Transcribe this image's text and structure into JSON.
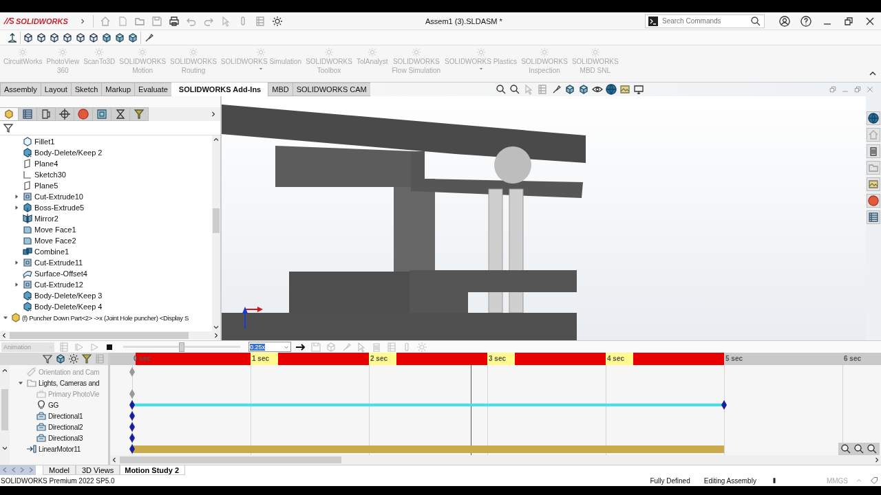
{
  "title_bar": {
    "app_name": "SOLIDWORKS",
    "document_title": "Assem1 (3).SLDASM *",
    "search": {
      "placeholder": "Search Commands"
    }
  },
  "command_manager": {
    "addins": [
      {
        "label": "CircuitWorks",
        "disabled": true,
        "dropdown": false
      },
      {
        "label": "PhotoView\n360",
        "disabled": true,
        "dropdown": false
      },
      {
        "label": "ScanTo3D",
        "disabled": true,
        "dropdown": false
      },
      {
        "label": "SOLIDWORKS\nMotion",
        "disabled": true,
        "dropdown": false
      },
      {
        "label": "SOLIDWORKS\nRouting",
        "disabled": true,
        "dropdown": false
      },
      {
        "label": "SOLIDWORKS Simulation",
        "disabled": true,
        "dropdown": true
      },
      {
        "label": "SOLIDWORKS\nToolbox",
        "disabled": true,
        "dropdown": false
      },
      {
        "label": "TolAnalyst",
        "disabled": true,
        "dropdown": false
      },
      {
        "label": "SOLIDWORKS\nFlow Simulation",
        "disabled": true,
        "dropdown": false
      },
      {
        "label": "SOLIDWORKS Plastics",
        "disabled": true,
        "dropdown": true
      },
      {
        "label": "SOLIDWORKS\nInspection",
        "disabled": true,
        "dropdown": false
      },
      {
        "label": "SOLIDWORKS\nMBD SNL",
        "disabled": true,
        "dropdown": false
      }
    ],
    "tabs": [
      {
        "label": "Assembly",
        "selected": false
      },
      {
        "label": "Layout",
        "selected": false
      },
      {
        "label": "Sketch",
        "selected": false
      },
      {
        "label": "Markup",
        "selected": false
      },
      {
        "label": "Evaluate",
        "selected": false
      },
      {
        "label": "SOLIDWORKS Add-Ins",
        "selected": true
      },
      {
        "label": "MBD",
        "selected": false
      },
      {
        "label": "SOLIDWORKS CAM",
        "selected": false
      }
    ]
  },
  "feature_manager": {
    "panel_tabs": [
      {
        "kind": "part",
        "selected": true
      },
      {
        "kind": "list",
        "selected": false
      },
      {
        "kind": "config",
        "selected": false
      },
      {
        "kind": "target",
        "selected": false
      },
      {
        "kind": "appearance",
        "selected": false
      },
      {
        "kind": "display",
        "selected": false
      },
      {
        "kind": "hourglass",
        "selected": false
      },
      {
        "kind": "funnel",
        "selected": false
      }
    ],
    "features": [
      {
        "label": "Fillet1",
        "kind": "fillet"
      },
      {
        "label": "Body-Delete/Keep 2",
        "kind": "body-delete"
      },
      {
        "label": "Plane4",
        "kind": "plane"
      },
      {
        "label": "Sketch30",
        "kind": "sketch"
      },
      {
        "label": "Plane5",
        "kind": "plane"
      },
      {
        "label": "Cut-Extrude10",
        "kind": "cut",
        "expanded": false
      },
      {
        "label": "Boss-Extrude5",
        "kind": "boss",
        "expanded": false
      },
      {
        "label": "Mirror2",
        "kind": "mirror"
      },
      {
        "label": "Move Face1",
        "kind": "move-face"
      },
      {
        "label": "Move Face2",
        "kind": "move-face"
      },
      {
        "label": "Combine1",
        "kind": "combine"
      },
      {
        "label": "Cut-Extrude11",
        "kind": "cut",
        "expanded": false
      },
      {
        "label": "Surface-Offset4",
        "kind": "surface"
      },
      {
        "label": "Cut-Extrude12",
        "kind": "cut",
        "expanded": false
      },
      {
        "label": "Body-Delete/Keep 3",
        "kind": "body-delete"
      },
      {
        "label": "Body-Delete/Keep 4",
        "kind": "body-delete"
      }
    ],
    "components": [
      {
        "label": "(f) Puncher Down Part<2> ->x (Joint Hole puncher) <Display S",
        "expanded": true
      }
    ]
  },
  "motion_study": {
    "mode": {
      "value": "Animation",
      "disabled": true
    },
    "playback": {
      "level": 0.5
    },
    "speed": {
      "value": "0.25x"
    },
    "ruler": [
      "0 sec",
      "1 sec",
      "2 sec",
      "3 sec",
      "4 sec",
      "5 sec",
      "6 sec"
    ],
    "time_cursor": {
      "level": 0.572
    },
    "tracks": [
      {
        "label": "Orientation and Cam",
        "kind": "camera",
        "disabled": true,
        "keyframe": true
      },
      {
        "label": "Lights, Cameras and",
        "kind": "folder",
        "disabled": false,
        "keyframe": false,
        "expanded": true,
        "children": [
          {
            "label": "Primary PhotoVie",
            "kind": "photo",
            "disabled": true,
            "keyframe": true
          },
          {
            "label": "GG",
            "kind": "bulb",
            "disabled": false,
            "keyframe": true,
            "color": "#3fe3f0",
            "end_keyframe": true
          },
          {
            "label": "Directional1",
            "kind": "light",
            "disabled": false,
            "keyframe": true
          },
          {
            "label": "Directional2",
            "kind": "light",
            "disabled": false,
            "keyframe": true
          },
          {
            "label": "Directional3",
            "kind": "light",
            "disabled": false,
            "keyframe": true
          }
        ]
      },
      {
        "label": "LinearMotor11",
        "kind": "motor",
        "disabled": false,
        "keyframe": true,
        "color": "#c9ab4b",
        "end_keyframe": false
      }
    ]
  },
  "bottom_tabs": [
    {
      "label": "Model",
      "selected": false
    },
    {
      "label": "3D Views",
      "selected": false
    },
    {
      "label": "Motion Study 2",
      "selected": true
    }
  ],
  "status_bar": {
    "product": "SOLIDWORKS Premium 2022 SP5.0",
    "definition": "Fully Defined",
    "mode": "Editing Assembly",
    "units": "MMGS"
  }
}
